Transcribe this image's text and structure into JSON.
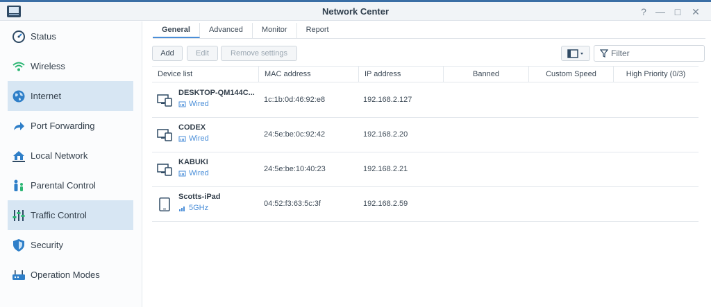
{
  "window": {
    "title": "Network Center",
    "controls": [
      "?",
      "—",
      "□",
      "✕"
    ]
  },
  "sidebar": {
    "items": [
      {
        "label": "Status",
        "icon": "status-gauge-icon",
        "active": false
      },
      {
        "label": "Wireless",
        "icon": "wifi-icon",
        "active": false
      },
      {
        "label": "Internet",
        "icon": "globe-icon",
        "active": true
      },
      {
        "label": "Port Forwarding",
        "icon": "forward-arrow-icon",
        "active": false
      },
      {
        "label": "Local Network",
        "icon": "home-network-icon",
        "active": false
      },
      {
        "label": "Parental Control",
        "icon": "family-icon",
        "active": false
      },
      {
        "label": "Traffic Control",
        "icon": "sliders-icon",
        "active": true
      },
      {
        "label": "Security",
        "icon": "shield-icon",
        "active": false
      },
      {
        "label": "Operation Modes",
        "icon": "router-icon",
        "active": false
      }
    ]
  },
  "tabs": [
    "General",
    "Advanced",
    "Monitor",
    "Report"
  ],
  "active_tab": "General",
  "toolbar": {
    "add_label": "Add",
    "edit_label": "Edit",
    "remove_label": "Remove settings",
    "filter_placeholder": "Filter"
  },
  "table": {
    "columns": [
      "Device list",
      "MAC address",
      "IP address",
      "Banned",
      "Custom Speed",
      "High Priority (0/3)"
    ],
    "rows": [
      {
        "name": "DESKTOP-QM144C...",
        "connection": "Wired",
        "device": "desktop-laptop-icon",
        "mac": "1c:1b:0d:46:92:e8",
        "ip": "192.168.2.127"
      },
      {
        "name": "CODEX",
        "connection": "Wired",
        "device": "desktop-laptop-icon",
        "mac": "24:5e:be:0c:92:42",
        "ip": "192.168.2.20"
      },
      {
        "name": "KABUKI",
        "connection": "Wired",
        "device": "desktop-laptop-icon",
        "mac": "24:5e:be:10:40:23",
        "ip": "192.168.2.21"
      },
      {
        "name": "Scotts-iPad",
        "connection": "5GHz",
        "device": "tablet-icon",
        "mac": "04:52:f3:63:5c:3f",
        "ip": "192.168.2.59"
      }
    ]
  },
  "colors": {
    "accent": "#4a8ed8",
    "active_bg": "#d7e6f3",
    "icon_blue": "#2f7fc8"
  }
}
